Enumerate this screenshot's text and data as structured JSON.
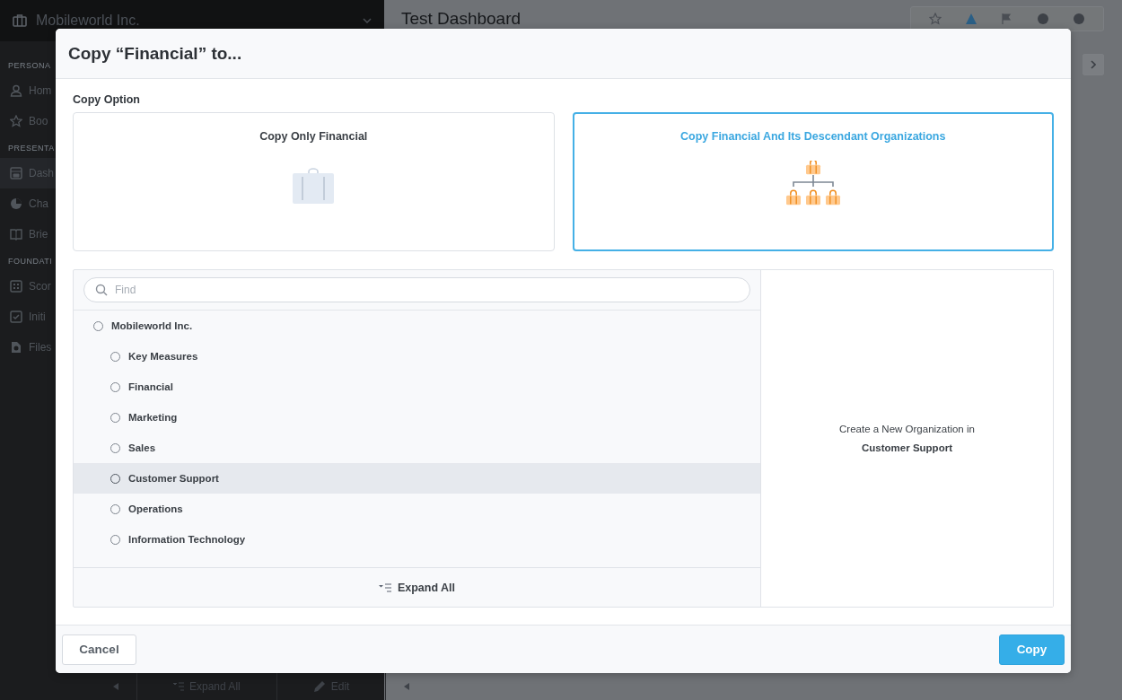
{
  "app": {
    "org_name": "Mobileworld Inc.",
    "page_title": "Test Dashboard",
    "sidebar": {
      "sections": [
        {
          "label": "PERSONA",
          "items": [
            {
              "label": "Hom",
              "selected": false
            },
            {
              "label": "Boo",
              "selected": false
            }
          ]
        },
        {
          "label": "PRESENTA",
          "items": [
            {
              "label": "Dash",
              "selected": true
            },
            {
              "label": "Cha",
              "selected": false
            },
            {
              "label": "Brie",
              "selected": false
            }
          ]
        },
        {
          "label": "FOUNDATI",
          "items": [
            {
              "label": "Scor",
              "selected": false
            },
            {
              "label": "Initi",
              "selected": false
            },
            {
              "label": "Files",
              "selected": false
            }
          ]
        }
      ]
    },
    "bottom_bar": {
      "expand_label": "Expand All",
      "edit_label": "Edit"
    }
  },
  "dialog": {
    "title": "Copy “Financial” to...",
    "section_label": "Copy Option",
    "options": [
      {
        "label": "Copy Only Financial",
        "kind": "single",
        "selected": false
      },
      {
        "label": "Copy Financial And Its Descendant Organizations",
        "kind": "tree",
        "selected": true
      }
    ],
    "tree": {
      "search_placeholder": "Find",
      "expand_label": "Expand All",
      "nodes": [
        {
          "label": "Mobileworld Inc.",
          "selected": false,
          "children": [
            {
              "label": "Key Measures",
              "selected": false
            },
            {
              "label": "Financial",
              "selected": false
            },
            {
              "label": "Marketing",
              "selected": false
            },
            {
              "label": "Sales",
              "selected": false
            },
            {
              "label": "Customer Support",
              "selected": true
            },
            {
              "label": "Operations",
              "selected": false
            },
            {
              "label": "Information Technology",
              "selected": false
            }
          ]
        }
      ]
    },
    "detail": {
      "line_1": "Create a New Organization in",
      "target": "Customer Support"
    },
    "buttons": [
      {
        "label": "Cancel",
        "kind": "secondary"
      },
      {
        "label": "Copy",
        "kind": "primary"
      }
    ]
  }
}
